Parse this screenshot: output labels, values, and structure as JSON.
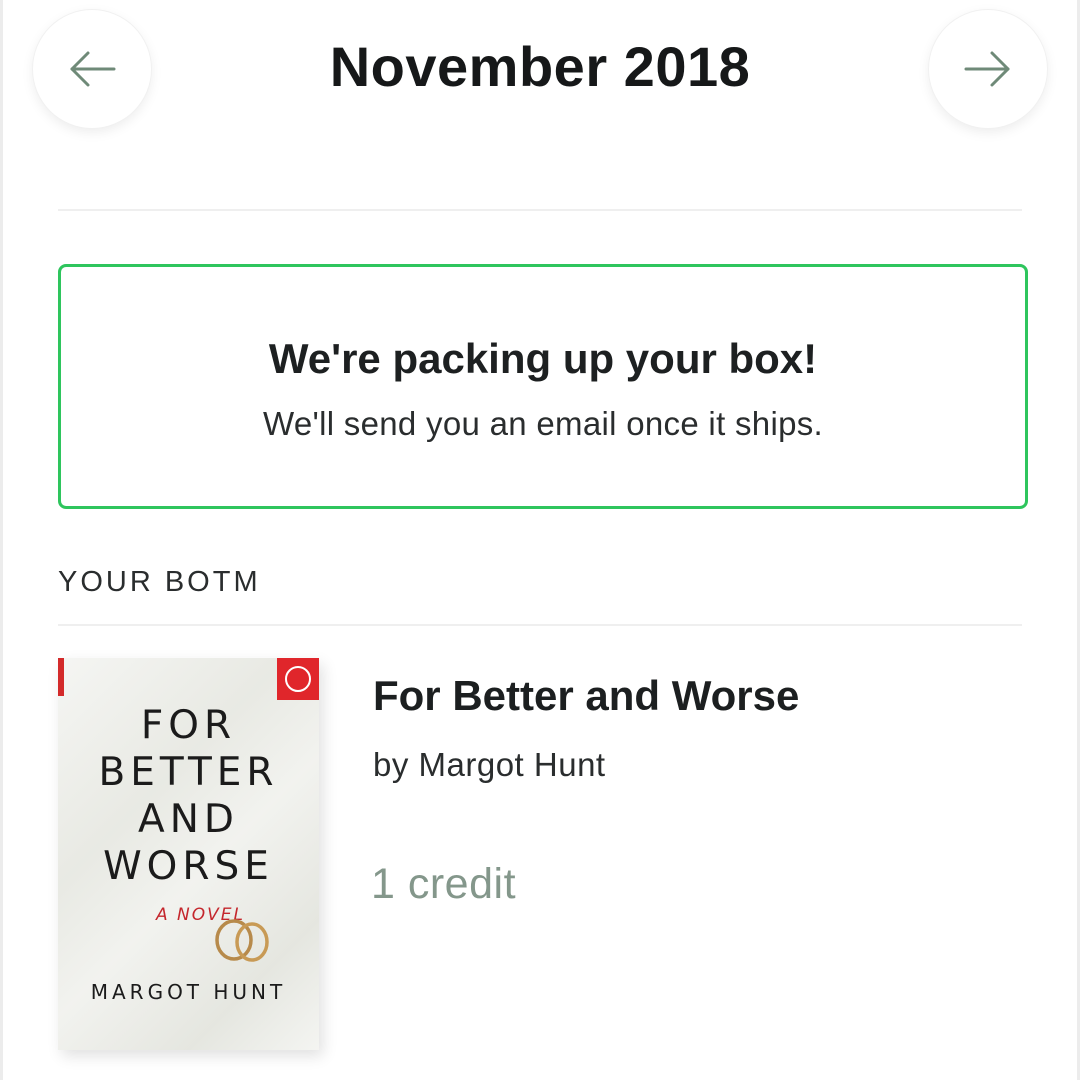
{
  "header": {
    "month_title": "November 2018",
    "prev_icon": "arrow-left-icon",
    "next_icon": "arrow-right-icon",
    "arrow_color": "#6f8a78"
  },
  "status": {
    "title": "We're packing up your box!",
    "subtitle": "We'll send you an email once it ships.",
    "border_color": "#2ec55d"
  },
  "section": {
    "label": "YOUR BOTM"
  },
  "book": {
    "title": "For Better and Worse",
    "author": "by Margot Hunt",
    "credit": "1 credit",
    "cover": {
      "title_lines": [
        "FOR",
        "BETTER",
        "AND",
        "WORSE"
      ],
      "tagline": "A NOVEL",
      "author": "MARGOT HUNT",
      "logo_icon": "botm-logo-icon",
      "accent_color": "#e0262b"
    }
  }
}
